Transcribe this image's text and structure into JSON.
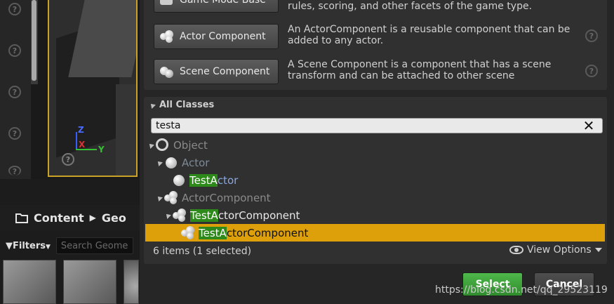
{
  "common_classes": [
    {
      "label": "Game Mode Base",
      "description": "rules, scoring, and other facets of the game type.",
      "icon": "game-mode-icon"
    },
    {
      "label": "Actor Component",
      "description": "An ActorComponent is a reusable component that can be added to any actor.",
      "icon": "actor-component-icon"
    },
    {
      "label": "Scene Component",
      "description": "A Scene Component is a component that has a scene transform and can be attached to other scene",
      "icon": "scene-component-icon"
    }
  ],
  "all_classes": {
    "header": "All Classes",
    "search_value": "testa",
    "tree": [
      {
        "label": "Object",
        "icon": "object-icon"
      },
      {
        "label": "Actor",
        "icon": "actor-icon"
      },
      {
        "highlight": "TestA",
        "rest": "ctor",
        "icon": "actor-icon"
      },
      {
        "label": "ActorComponent",
        "icon": "actor-component-icon"
      },
      {
        "highlight": "TestA",
        "rest": "ctorComponent",
        "icon": "actor-component-icon"
      },
      {
        "highlight": "TestA",
        "rest": "ctorComponent",
        "icon": "actor-component-icon",
        "selected": true
      }
    ],
    "status": "6 items (1 selected)",
    "view_options": "View Options"
  },
  "buttons": {
    "select": "Select",
    "cancel": "Cancel"
  },
  "content_browser": {
    "breadcrumb": [
      "Content",
      "Geo"
    ],
    "filters_label": "Filters",
    "search_placeholder": "Search Geome"
  },
  "viewport": {
    "axis_z": "Z",
    "axis_x": "X",
    "axis_y": "Y"
  },
  "watermark": "https://blog.csdn.net/qq_29523119",
  "colors": {
    "selection": "#dd9f0a",
    "match_highlight": "#2d8a1a",
    "select_button": "#3fa53a"
  }
}
